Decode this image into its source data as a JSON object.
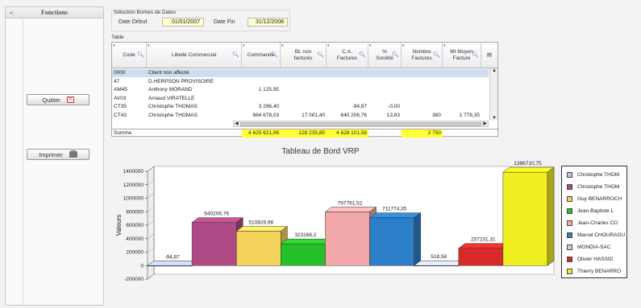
{
  "sidebar": {
    "title": "Fonctions",
    "quit_label": "Quitter",
    "print_label": "Imprimer"
  },
  "selection": {
    "legend": "Sélection Bornes de Dates",
    "start_label": "Date Début",
    "start_value": "01/01/2007",
    "end_label": "Date Fin",
    "end_value": "31/12/2008"
  },
  "table": {
    "title": "Table",
    "headers": {
      "code": "Code",
      "libelle": "Libellé Commercial",
      "commande": "Commande",
      "bl1": "BL non",
      "bl2": "facturés",
      "ca1": "C.A.",
      "ca2": "Factures",
      "pct1": "%",
      "pct2": "Société",
      "nb1": "Nombre",
      "nb2": "Factures",
      "mt1": "Mt Moyen",
      "mt2": "Facture"
    },
    "rows": [
      {
        "code": "0000",
        "libelle": "Client non affecté",
        "commande": "",
        "bl": "",
        "ca": "",
        "pct": "",
        "nb": "",
        "mt": ""
      },
      {
        "code": "47",
        "libelle": "D.HERPSON PROVISOIRE",
        "commande": "",
        "bl": "",
        "ca": "",
        "pct": "",
        "nb": "",
        "mt": ""
      },
      {
        "code": "AM45",
        "libelle": "Anthony MORAND",
        "commande": "1 125,95",
        "bl": "",
        "ca": "",
        "pct": "",
        "nb": "",
        "mt": ""
      },
      {
        "code": "AV03",
        "libelle": "Arnaud VIRATELLE",
        "commande": "",
        "bl": "",
        "ca": "",
        "pct": "",
        "nb": "",
        "mt": ""
      },
      {
        "code": "CT35",
        "libelle": "Christophe THOMAS",
        "commande": "3 296,40",
        "bl": "",
        "ca": "-94,87",
        "pct": "-0,00",
        "nb": "",
        "mt": ""
      },
      {
        "code": "CT43",
        "libelle": "Christophe THOMAS",
        "commande": "664 678,03",
        "bl": "17 081,40",
        "ca": "640 206,76",
        "pct": "13,83",
        "nb": "360",
        "mt": "1 778,35"
      }
    ],
    "sum": {
      "label": "Somme",
      "commande": "4 625 621,06",
      "bl": "128 235,85",
      "ca": "4 628 101,56",
      "nb": "2 750"
    }
  },
  "chart_data": {
    "type": "bar",
    "title": "Tableau de Bord VRP",
    "ylabel": "Valeurs",
    "ylim": [
      -200000,
      1400000
    ],
    "yticks": [
      "1400000",
      "1200000",
      "1000000",
      "800000",
      "600000",
      "400000",
      "200000",
      "0",
      "-200000"
    ],
    "legend_position": "right",
    "categories": [
      "Christophe THOM",
      "Christophe THOM",
      "Guy BENARROCH",
      "Jean-Baptiste L",
      "Jean-Charles CO",
      "Marcel CHOURAGU",
      "MONDIA-SAC",
      "Olivier HASSID",
      "Thierry BENARRO"
    ],
    "values": [
      -94.87,
      640206.76,
      510826.96,
      323166.2,
      797761.52,
      711774.35,
      518.58,
      257231.31,
      1386710.75
    ],
    "labels": [
      "-94,87",
      "640206,76",
      "510826,96",
      "323166,2",
      "797761,52",
      "711774,35",
      "518,58",
      "257231,31",
      "1386710,75"
    ],
    "colors": [
      "#b8c4f0",
      "#b04a86",
      "#f3d35a",
      "#28c028",
      "#f2a8a8",
      "#2c7ec8",
      "#c8d0f0",
      "#d82a2a",
      "#f0f020"
    ]
  }
}
